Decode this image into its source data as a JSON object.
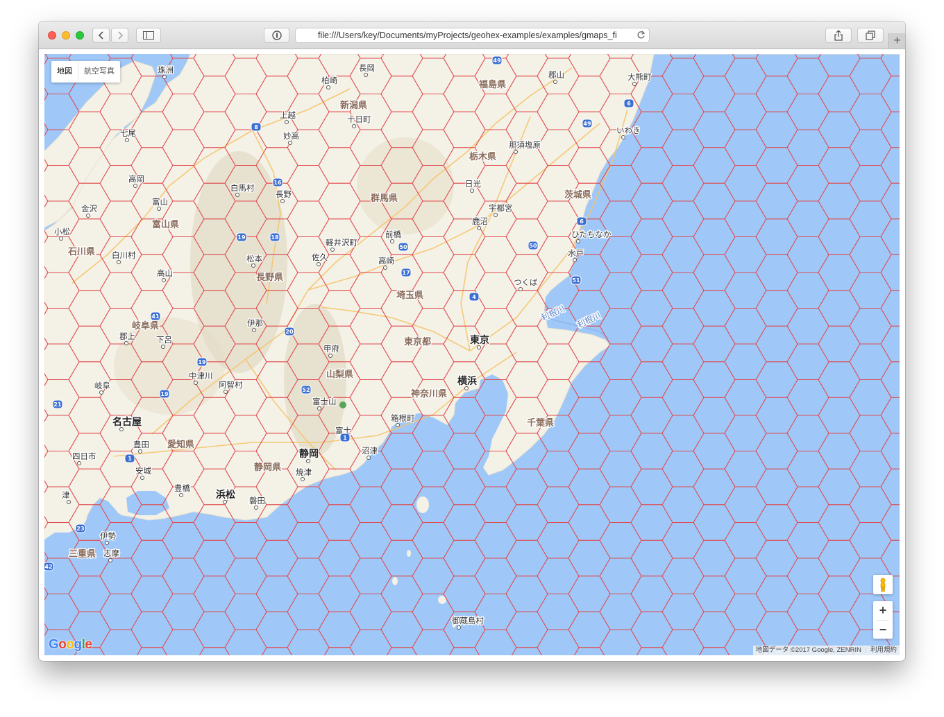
{
  "browser": {
    "url": "file:///Users/key/Documents/myProjects/geohex-examples/examples/gmaps_fi",
    "new_tab_label": "+"
  },
  "map": {
    "type_control": {
      "map": "地図",
      "satellite": "航空写真"
    },
    "zoom_in": "+",
    "zoom_out": "−",
    "attribution": "地図データ ©2017 Google, ZENRIN",
    "terms": "利用規約",
    "logo": [
      "G",
      "o",
      "o",
      "g",
      "l",
      "e"
    ],
    "hex_color": "#e0494e",
    "water_color": "#9fc8f8",
    "land_color": "#f4f1e6",
    "labels": {
      "prefectures": [
        "新潟県",
        "福島県",
        "栃木県",
        "群馬県",
        "茨城県",
        "富山県",
        "石川県",
        "長野県",
        "埼玉県",
        "岐阜県",
        "山梨県",
        "東京都",
        "神奈川県",
        "千葉県",
        "愛知県",
        "静岡県",
        "三重県"
      ],
      "major_cities": [
        "東京",
        "横浜",
        "名古屋",
        "静岡",
        "浜松"
      ],
      "cities": [
        "珠洲",
        "長岡",
        "柏崎",
        "郡山",
        "大熊町",
        "上越",
        "十日町",
        "妙高",
        "いわき",
        "七尾",
        "那須塩原",
        "高岡",
        "白馬村",
        "長野",
        "日光",
        "富山",
        "宇都宮",
        "金沢",
        "鹿沼",
        "小松",
        "ひたちなか",
        "軽井沢町",
        "前橋",
        "白川村",
        "松本",
        "佐久",
        "高崎",
        "水戸",
        "高山",
        "つくば",
        "伊那",
        "郡上",
        "下呂",
        "甲府",
        "中津川",
        "阿智村",
        "岐阜",
        "富士山",
        "箱根町",
        "豊田",
        "富士",
        "四日市",
        "沼津",
        "安城",
        "焼津",
        "豊橋",
        "磐田",
        "伊勢",
        "志摩",
        "御蔵島村",
        "津"
      ],
      "rivers": [
        "利根川",
        "利根川"
      ]
    },
    "road_shields": [
      "49",
      "6",
      "8",
      "49",
      "16",
      "19",
      "18",
      "50",
      "50",
      "6",
      "51",
      "17",
      "4",
      "41",
      "20",
      "19",
      "52",
      "19",
      "21",
      "1",
      "1",
      "23",
      "42"
    ]
  }
}
